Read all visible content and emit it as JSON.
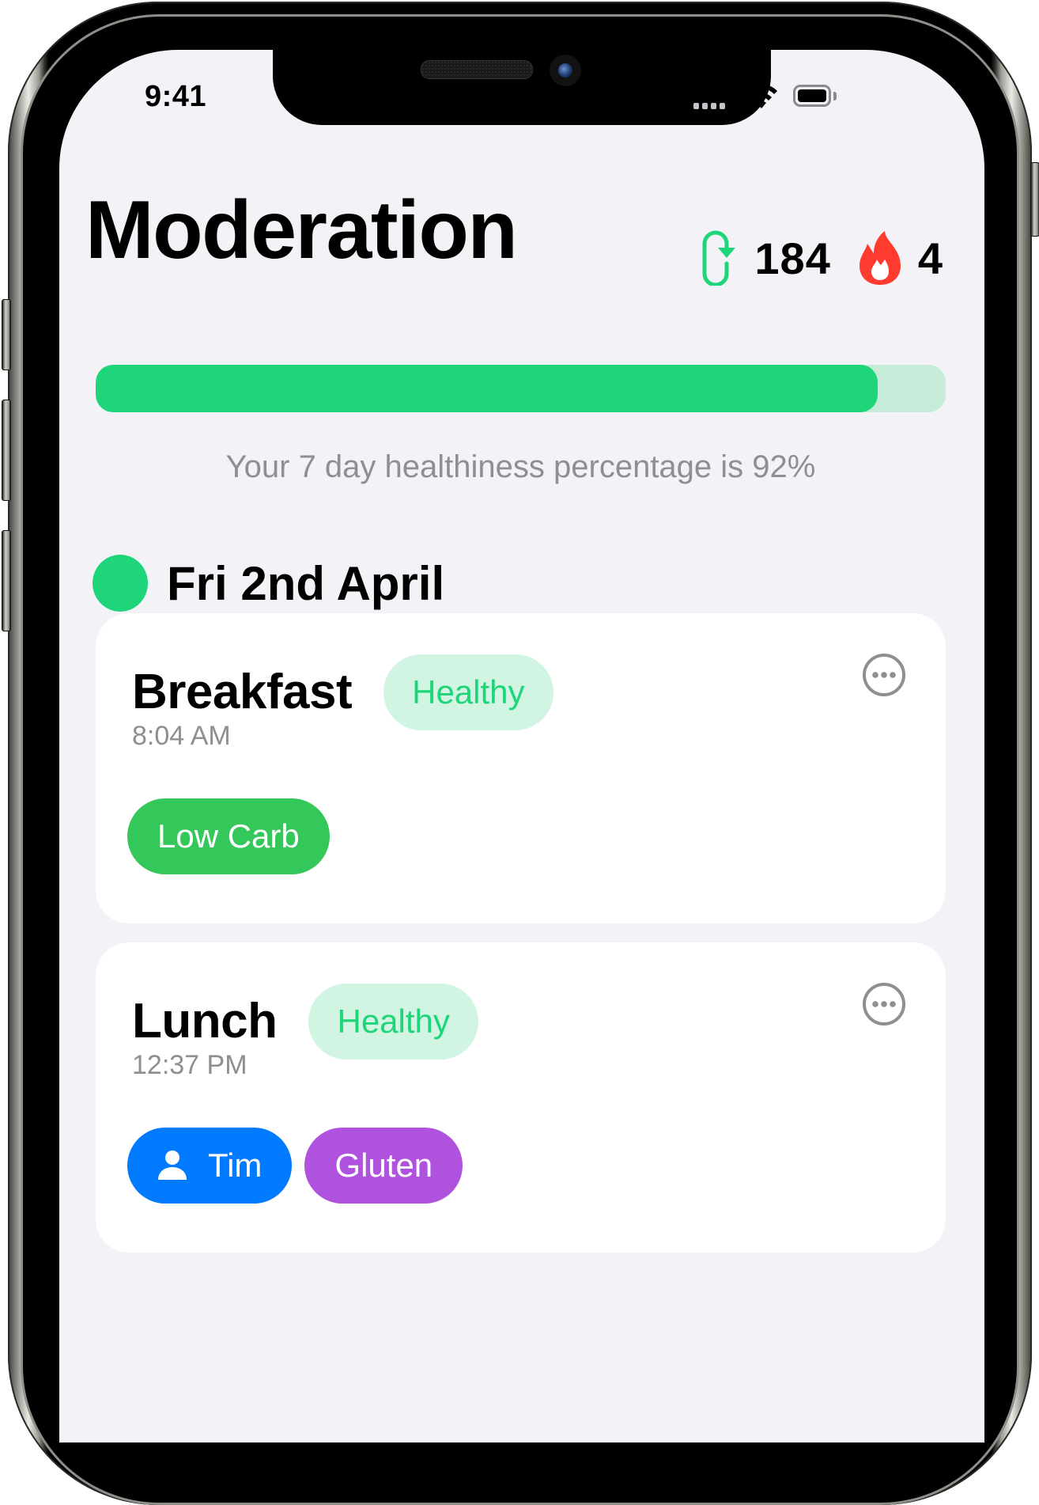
{
  "status_bar": {
    "time": "9:41",
    "signal_icon": "cellular-signal-icon",
    "wifi_icon": "wifi-icon",
    "battery_icon": "battery-icon"
  },
  "header": {
    "title": "Moderation",
    "stats": [
      {
        "icon": "refresh-cycle-icon",
        "value": "184",
        "color": "#1ed57a"
      },
      {
        "icon": "flame-icon",
        "value": "4",
        "color": "#ff3b30"
      }
    ]
  },
  "progress": {
    "percent": 92,
    "fill_color": "#1ed57a",
    "track_color": "#c6ebd9",
    "caption": "Your 7 day healthiness percentage is 92%"
  },
  "day": {
    "label": "Fri 2nd April",
    "status_color": "#1ed57a"
  },
  "meals": [
    {
      "name": "Breakfast",
      "rating": "Healthy",
      "time": "8:04 AM",
      "more_icon": "ellipsis-circle-icon",
      "tags": [
        {
          "label": "Low Carb",
          "color": "#34c759",
          "icon": null
        }
      ]
    },
    {
      "name": "Lunch",
      "rating": "Healthy",
      "time": "12:37 PM",
      "more_icon": "ellipsis-circle-icon",
      "tags": [
        {
          "label": "Tim",
          "color": "#007aff",
          "icon": "person-icon"
        },
        {
          "label": "Gluten",
          "color": "#af52de",
          "icon": null
        }
      ]
    }
  ],
  "colors": {
    "background": "#f2f2f7",
    "card": "#ffffff",
    "healthy_badge_bg": "#d2f5e3",
    "healthy_badge_text": "#1ed57a",
    "secondary_text": "#8e8e93"
  }
}
